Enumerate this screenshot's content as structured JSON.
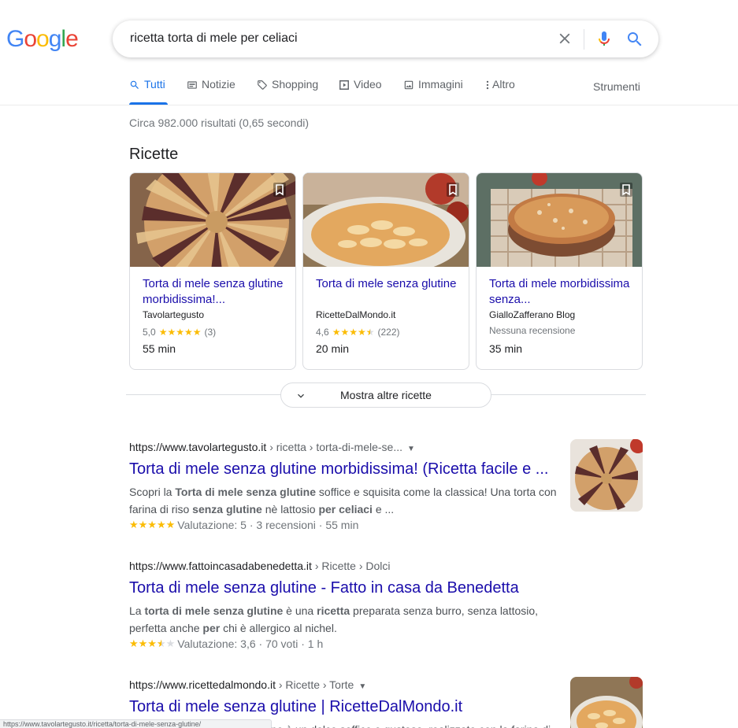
{
  "logo": {
    "text": "Google"
  },
  "search": {
    "query": "ricetta torta di mele per celiaci"
  },
  "tabs": [
    {
      "label": "Tutti",
      "icon": "search-icon",
      "active": true
    },
    {
      "label": "Notizie",
      "icon": "news-icon"
    },
    {
      "label": "Shopping",
      "icon": "tag-icon"
    },
    {
      "label": "Video",
      "icon": "play-icon"
    },
    {
      "label": "Immagini",
      "icon": "image-icon"
    },
    {
      "label": "Altro",
      "icon": "more-vert-icon"
    }
  ],
  "tools_label": "Strumenti",
  "result_stats": "Circa 982.000 risultati (0,65 secondi)",
  "recipes": {
    "heading": "Ricette",
    "cards": [
      {
        "title": "Torta di mele senza glutine morbidissima!...",
        "source": "Tavolartegusto",
        "rating": "5,0",
        "stars": 5,
        "reviews": "(3)",
        "time": "55 min"
      },
      {
        "title": "Torta di mele senza glutine",
        "source": "RicetteDalMondo.it",
        "rating": "4,6",
        "stars": 4.5,
        "reviews": "(222)",
        "time": "20 min"
      },
      {
        "title": "Torta di mele morbidissima senza...",
        "source": "GialloZafferano Blog",
        "no_review": "Nessuna recensione",
        "time": "35 min"
      }
    ],
    "more_label": "Mostra altre ricette"
  },
  "results": [
    {
      "domain": "https://www.tavolartegusto.it",
      "path": " › ricetta › torta-di-mele-se...",
      "has_caret": true,
      "title": "Torta di mele senza glutine morbidissima! (Ricetta facile e ...",
      "snippet_html": "Scopri la <b>Torta di mele senza glutine</b> soffice e squisita come la classica! Una torta con farina di riso <b>senza glutine</b> nè lattosio <b>per celiaci</b> e ...",
      "stars": 5,
      "meta": "Valutazione: 5 · 3 recensioni · 55 min"
    },
    {
      "domain": "https://www.fattoincasadabenedetta.it",
      "path": " › Ricette › Dolci",
      "has_caret": false,
      "title": "Torta di mele senza glutine - Fatto in casa da Benedetta",
      "snippet_html": "La <b>torta di mele senza glutine</b> è una <b>ricetta</b> preparata senza burro, senza lattosio, perfetta anche <b>per</b> chi è allergico al nichel.",
      "stars": 3.5,
      "meta": "Valutazione: 3,6 · 70 voti · 1 h"
    },
    {
      "domain": "https://www.ricettedalmondo.it",
      "path": " › Ricette › Torte",
      "has_caret": true,
      "title": "Torta di mele senza glutine | RicetteDalMondo.it",
      "snippet_html": "La <b>torta di mele senza glutine</b> è un dolce soffice e gustoso, realizzato con la farina di"
    }
  ],
  "status_bar": "https://www.tavolartegusto.it/ricetta/torta-di-mele-senza-glutine/",
  "colors": {
    "link": "#1a0dab",
    "accent": "#1a73e8",
    "star": "#fbbc04"
  }
}
